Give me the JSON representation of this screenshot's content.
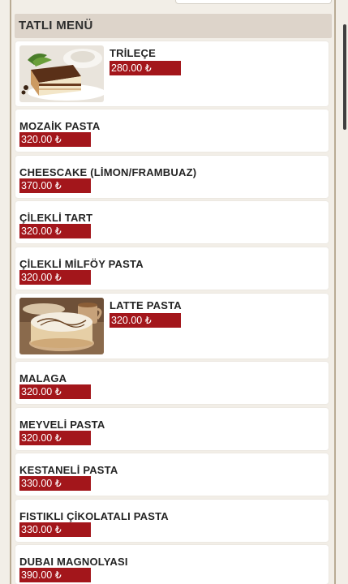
{
  "section_title": "TATLI MENÜ",
  "items": [
    {
      "name": "TRİLEÇE",
      "price": "280.00 ₺"
    },
    {
      "name": "MOZAİK PASTA",
      "price": "320.00 ₺"
    },
    {
      "name": "CHEESCAKE (LİMON/FRAMBUAZ)",
      "price": "370.00 ₺"
    },
    {
      "name": "ÇİLEKLİ TART",
      "price": "320.00 ₺"
    },
    {
      "name": "ÇİLEKLİ MİLFÖY PASTA",
      "price": "320.00 ₺"
    },
    {
      "name": "LATTE PASTA",
      "price": "320.00 ₺"
    },
    {
      "name": "MALAGA",
      "price": "320.00 ₺"
    },
    {
      "name": "MEYVELİ PASTA",
      "price": "320.00 ₺"
    },
    {
      "name": "KESTANELİ PASTA",
      "price": "330.00 ₺"
    },
    {
      "name": "FISTIKLI ÇİKOLATALI PASTA",
      "price": "330.00 ₺"
    },
    {
      "name": "DUBAI MAGNOLYASI",
      "price": "390.00 ₺"
    }
  ],
  "colors": {
    "accent": "#a3161b",
    "header_bg": "#ddd4ca",
    "page_bg": "#f2eee7"
  }
}
